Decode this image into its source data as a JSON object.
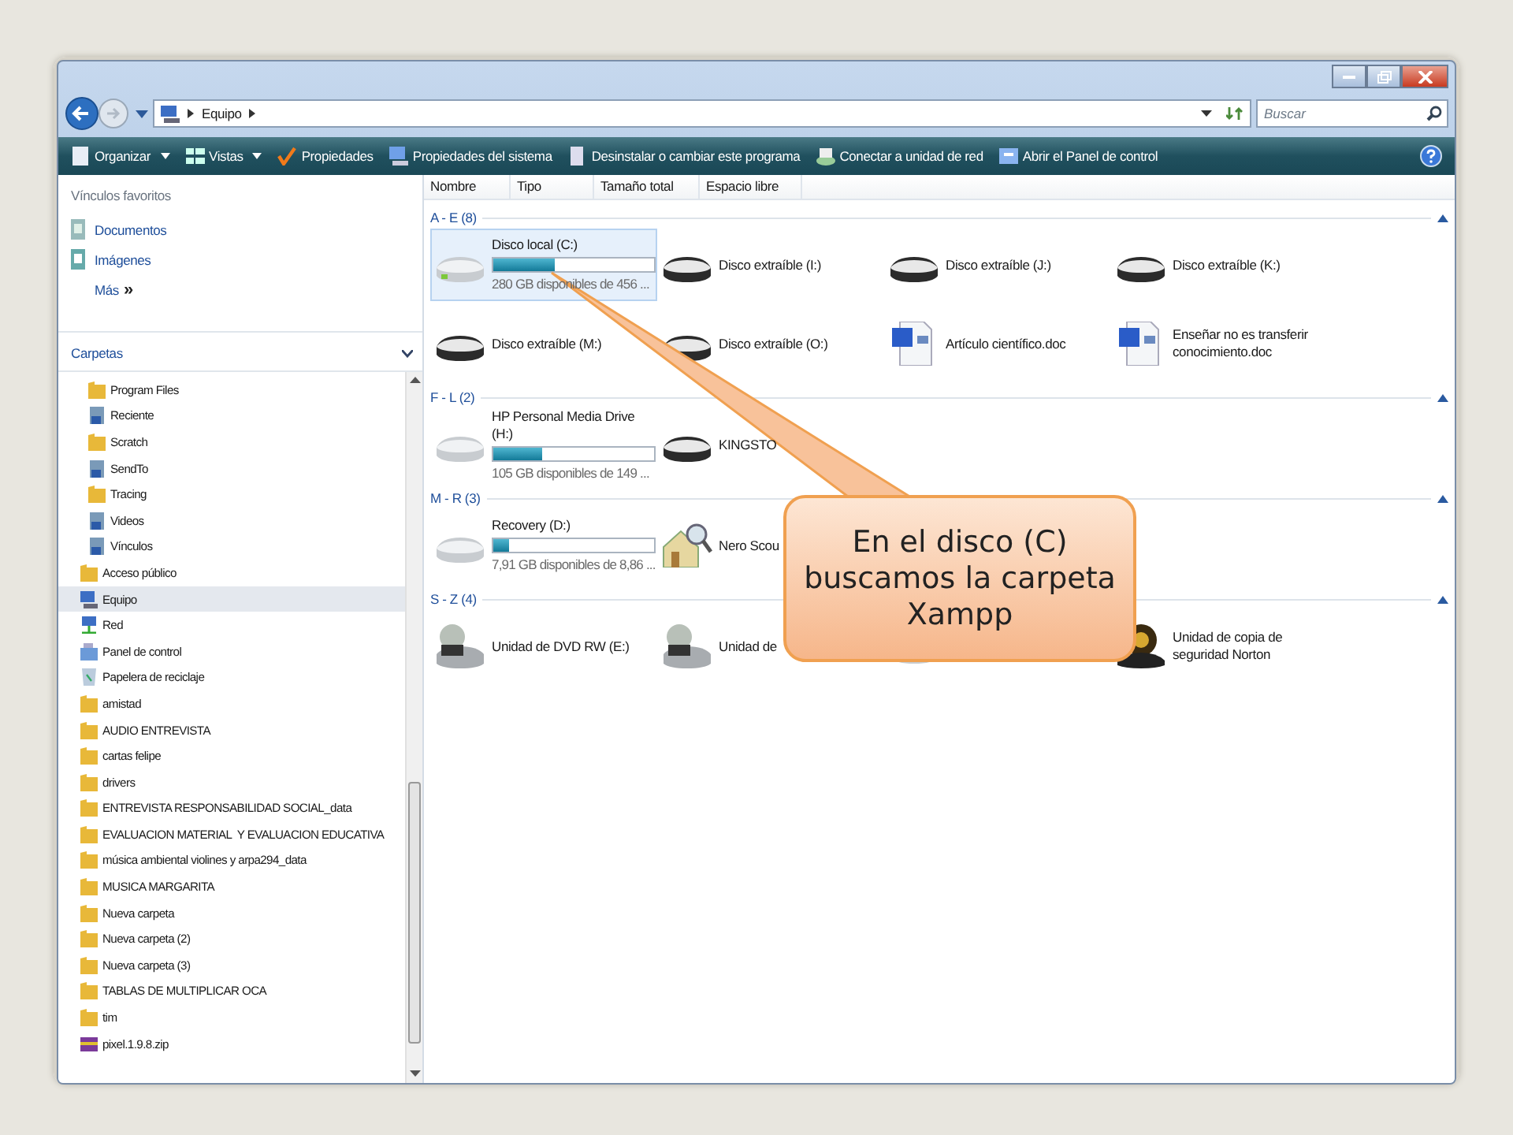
{
  "address": {
    "crumbs": [
      "Equipo"
    ]
  },
  "search": {
    "placeholder": "Buscar"
  },
  "toolbar": [
    {
      "label": "Organizar",
      "kind": "organize",
      "dropdown": true
    },
    {
      "label": "Vistas",
      "kind": "views",
      "dropdown": true
    },
    {
      "label": "Propiedades",
      "kind": "check",
      "dropdown": false
    },
    {
      "label": "Propiedades del sistema",
      "kind": "computer",
      "dropdown": false
    },
    {
      "label": "Desinstalar o cambiar este programa",
      "kind": "uninstall",
      "dropdown": false
    },
    {
      "label": "Conectar a unidad de red",
      "kind": "network",
      "dropdown": false
    },
    {
      "label": "Abrir el Panel de control",
      "kind": "control",
      "dropdown": false
    }
  ],
  "favorites": {
    "title": "Vínculos favoritos",
    "links": [
      {
        "label": "Documentos",
        "kind": "documents"
      },
      {
        "label": "Imágenes",
        "kind": "pictures"
      }
    ],
    "more": "Más",
    "more_mark": "»"
  },
  "folders": {
    "title": "Carpetas",
    "tree": [
      {
        "children": [
          {
            "label": "Program Files",
            "kind": "folder",
            "selected": false
          },
          {
            "label": "Reciente",
            "kind": "special",
            "selected": false
          },
          {
            "label": "Scratch",
            "kind": "folder",
            "selected": false
          },
          {
            "label": "SendTo",
            "kind": "special",
            "selected": false
          },
          {
            "label": "Tracing",
            "kind": "folder",
            "selected": false
          },
          {
            "label": "Videos",
            "kind": "special",
            "selected": false
          },
          {
            "label": "Vínculos",
            "kind": "special",
            "selected": false
          }
        ]
      },
      {
        "label": "Acceso público",
        "kind": "folder",
        "selected": false
      },
      {
        "label": "Equipo",
        "kind": "computer",
        "selected": true
      },
      {
        "label": "Red",
        "kind": "network",
        "selected": false
      },
      {
        "label": "Panel de control",
        "kind": "control",
        "selected": false
      },
      {
        "label": "Papelera de reciclaje",
        "kind": "recycle",
        "selected": false
      },
      {
        "label": "amistad",
        "kind": "folder",
        "selected": false
      },
      {
        "label": "AUDIO ENTREVISTA",
        "kind": "folder",
        "selected": false
      },
      {
        "label": "cartas felipe",
        "kind": "folder",
        "selected": false
      },
      {
        "label": "drivers",
        "kind": "folder",
        "selected": false
      },
      {
        "label": "ENTREVISTA RESPONSABILIDAD SOCIAL_data",
        "kind": "folder",
        "selected": false
      },
      {
        "label": "EVALUACION MATERIAL  Y EVALUACION EDUCATIVA",
        "kind": "folder",
        "selected": false
      },
      {
        "label": "música ambiental violines y arpa294_data",
        "kind": "folder",
        "selected": false
      },
      {
        "label": "MUSICA MARGARITA",
        "kind": "folder",
        "selected": false
      },
      {
        "label": "Nueva carpeta",
        "kind": "folder",
        "selected": false
      },
      {
        "label": "Nueva carpeta (2)",
        "kind": "folder",
        "selected": false
      },
      {
        "label": "Nueva carpeta (3)",
        "kind": "folder",
        "selected": false
      },
      {
        "label": "TABLAS DE MULTIPLICAR OCA",
        "kind": "folder",
        "selected": false
      },
      {
        "label": "tim",
        "kind": "folder",
        "selected": false
      },
      {
        "label": "pixel.1.9.8.zip",
        "kind": "archive",
        "selected": false
      }
    ]
  },
  "columns": [
    "Nombre",
    "Tipo",
    "Tamaño total",
    "Espacio libre"
  ],
  "groups": [
    {
      "title": "A - E (8)",
      "items": [
        {
          "name": "Disco local (C:)",
          "kind": "system",
          "level": 0.38,
          "free": "280 GB disponibles de 456 ...",
          "selected": true
        },
        {
          "name": "Disco extraíble (I:)",
          "kind": "drive",
          "selected": false
        },
        {
          "name": "Disco extraíble (J:)",
          "kind": "drive",
          "selected": false
        },
        {
          "name": "Disco extraíble (K:)",
          "kind": "drive",
          "selected": false
        },
        {
          "name": "Disco extraíble (M:)",
          "kind": "drive",
          "selected": false
        },
        {
          "name": "Disco extraíble (O:)",
          "kind": "drive",
          "selected": false
        },
        {
          "name": "Artículo científico.doc",
          "kind": "doc",
          "selected": false
        },
        {
          "name": "Enseñar no es transferir conocimiento.doc",
          "kind": "doc",
          "selected": false
        }
      ]
    },
    {
      "title": "F - L (2)",
      "items": [
        {
          "name": "HP Personal Media Drive (H:)",
          "kind": "hdd",
          "level": 0.3,
          "free": "105 GB disponibles de 149 ...",
          "selected": false
        },
        {
          "name": "KINGSTO",
          "kind": "drive",
          "selected": false
        }
      ]
    },
    {
      "title": "M - R (3)",
      "items": [
        {
          "name": "Recovery (D:)",
          "kind": "hdd",
          "level": 0.1,
          "free": "7,91 GB disponibles de 8,86 ...",
          "selected": false
        },
        {
          "name": "Nero Scou",
          "kind": "app",
          "selected": false
        }
      ]
    },
    {
      "title": "S - Z (4)",
      "items": [
        {
          "name": "Unidad de DVD RW (E:)",
          "kind": "dvd",
          "selected": false
        },
        {
          "name": "Unidad de",
          "kind": "dvd",
          "selected": false
        },
        {
          "kind": "drive"
        },
        {
          "name": "Unidad de copia de seguridad Norton",
          "kind": "backup",
          "selected": false
        }
      ]
    }
  ],
  "callout": {
    "text": "En el disco (C) buscamos la carpeta Xampp"
  }
}
